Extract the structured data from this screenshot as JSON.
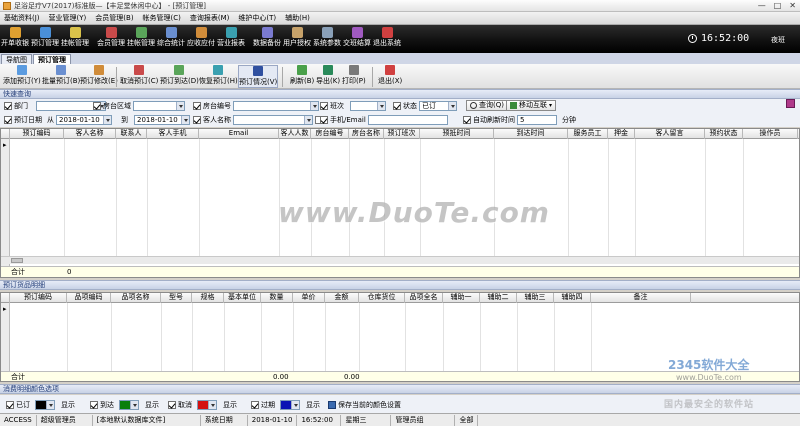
{
  "window": {
    "title": "足浴足疗V7(2017)标准版—【丰足堂休闲中心】 - [预订管理]",
    "controls": [
      "—",
      "□",
      "✕"
    ]
  },
  "menu": [
    "基础资料(J)",
    "营业管理(Y)",
    "会员管理(B)",
    "帐务管理(C)",
    "查询报表(M)",
    "维护中心(T)",
    "辅助(H)"
  ],
  "mainbar": {
    "buttons": [
      "开单收银",
      "预订管理",
      "挂帐管理",
      "会员管理",
      "挂帐管理",
      "综合统计",
      "应收应付",
      "营业报表",
      "数据备份",
      "用户授权",
      "系统参数",
      "交班结算",
      "退出系统"
    ],
    "clock": "16:52:00",
    "shift": "夜班"
  },
  "tabs": [
    "导航图",
    "预订管理"
  ],
  "toolbar": {
    "buttons": [
      "添加预订(Y)",
      "批量预订(B)",
      "预订修改(E)",
      "取消预订(C)",
      "预订到达(D)",
      "恢复预订(H)",
      "预订情况(V)",
      "刷新(B)",
      "导出(K)",
      "打印(P)",
      "退出(X)"
    ]
  },
  "quick_query": {
    "header": "快速查询",
    "filters": {
      "dept_label": "部门",
      "room_area_label": "房台区域",
      "room_no_label": "房台编号",
      "shift_label": "班次",
      "status_label": "状态",
      "status_value": "已订",
      "query_button": "查询(Q)",
      "mobile_button": "移动互联",
      "date_label": "预订日期",
      "from_label": "从",
      "date_from": "2018-01-10",
      "to_label": "到",
      "date_to": "2018-01-10",
      "customer_name_label": "客人名称",
      "phone_label": "手机/Email",
      "auto_refresh_label": "自动刷新时间",
      "auto_refresh_value": "5",
      "minutes_label": "分钟"
    }
  },
  "booking_grid": {
    "columns": [
      "预订编码",
      "客人名称",
      "联系人",
      "客人手机",
      "Email",
      "客人人数",
      "房台编号",
      "房台名称",
      "预订班次",
      "预抵时间",
      "到达时间",
      "服务员工",
      "押金",
      "客人留言",
      "预约状态",
      "操作员"
    ],
    "footer_label": "合计",
    "footer_value": "0"
  },
  "items_section": {
    "header": "预订货品明细",
    "columns": [
      "预订编码",
      "品项编码",
      "品项名称",
      "型号",
      "规格",
      "基本单位",
      "数量",
      "单价",
      "金额",
      "仓库货位",
      "品项全名",
      "辅助一",
      "辅助二",
      "辅助三",
      "辅助四",
      "备注"
    ],
    "footer_label": "合计",
    "footer_qty": "0.00",
    "footer_amount": "0.00"
  },
  "color_options": {
    "header": "消费明细颜色选项",
    "items": [
      {
        "label": "已订",
        "show": "显示",
        "color": "#000000"
      },
      {
        "label": "到达",
        "show": "显示",
        "color": "#0a7f0a"
      },
      {
        "label": "取消",
        "show": "显示",
        "color": "#d41111"
      },
      {
        "label": "过期",
        "show": "显示",
        "color": "#0a14b4"
      }
    ],
    "save_label": "保存当前的颜色设置"
  },
  "statusbar": {
    "items": [
      "ACCESS",
      "超级管理员",
      "[本地默认数据库文件]",
      "系统日期",
      "2018-01-10",
      "16:52:00",
      "星期三",
      "管理员组",
      "全部"
    ]
  },
  "watermarks": {
    "main": "www.DuoTe.com",
    "brand": "2345软件大全",
    "url": "www.DuoTe.com",
    "faded": "国内最安全的软件站"
  }
}
